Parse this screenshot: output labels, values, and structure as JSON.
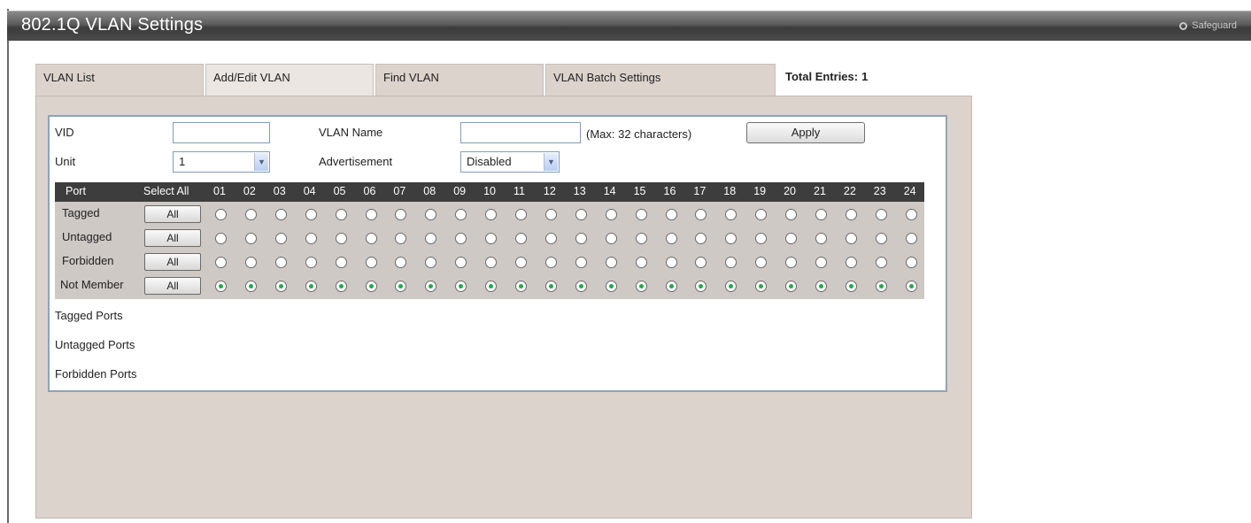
{
  "header": {
    "title": "802.1Q VLAN Settings",
    "safeguard_label": "Safeguard"
  },
  "tabs": [
    {
      "label": "VLAN List",
      "active": false
    },
    {
      "label": "Add/Edit VLAN",
      "active": true
    },
    {
      "label": "Find VLAN",
      "active": false
    },
    {
      "label": "VLAN Batch Settings",
      "active": false
    }
  ],
  "total_entries": {
    "label": "Total Entries:",
    "value": "1"
  },
  "form": {
    "vid_label": "VID",
    "vid_value": "",
    "vlan_name_label": "VLAN Name",
    "vlan_name_value": "",
    "max_chars_hint": "(Max: 32 characters)",
    "apply_label": "Apply",
    "unit_label": "Unit",
    "unit_value": "1",
    "advertisement_label": "Advertisement",
    "advertisement_value": "Disabled"
  },
  "port_table": {
    "port_header": "Port",
    "select_all_header": "Select All",
    "ports": [
      "01",
      "02",
      "03",
      "04",
      "05",
      "06",
      "07",
      "08",
      "09",
      "10",
      "11",
      "12",
      "13",
      "14",
      "15",
      "16",
      "17",
      "18",
      "19",
      "20",
      "21",
      "22",
      "23",
      "24"
    ],
    "rows": [
      {
        "label": "Tagged",
        "button": "All",
        "checked": false
      },
      {
        "label": "Untagged",
        "button": "All",
        "checked": false
      },
      {
        "label": "Forbidden",
        "button": "All",
        "checked": false
      },
      {
        "label": "Not Member",
        "button": "All",
        "checked": true
      }
    ]
  },
  "summary": {
    "tagged_ports_label": "Tagged Ports",
    "untagged_ports_label": "Untagged Ports",
    "forbidden_ports_label": "Forbidden Ports"
  },
  "colors": {
    "titlebar": "#3c3c3c",
    "panel": "#dcd3cd",
    "port_header": "#3d3d3d",
    "radio_checked": "#22a84a",
    "box_border": "#8fa3b6"
  }
}
